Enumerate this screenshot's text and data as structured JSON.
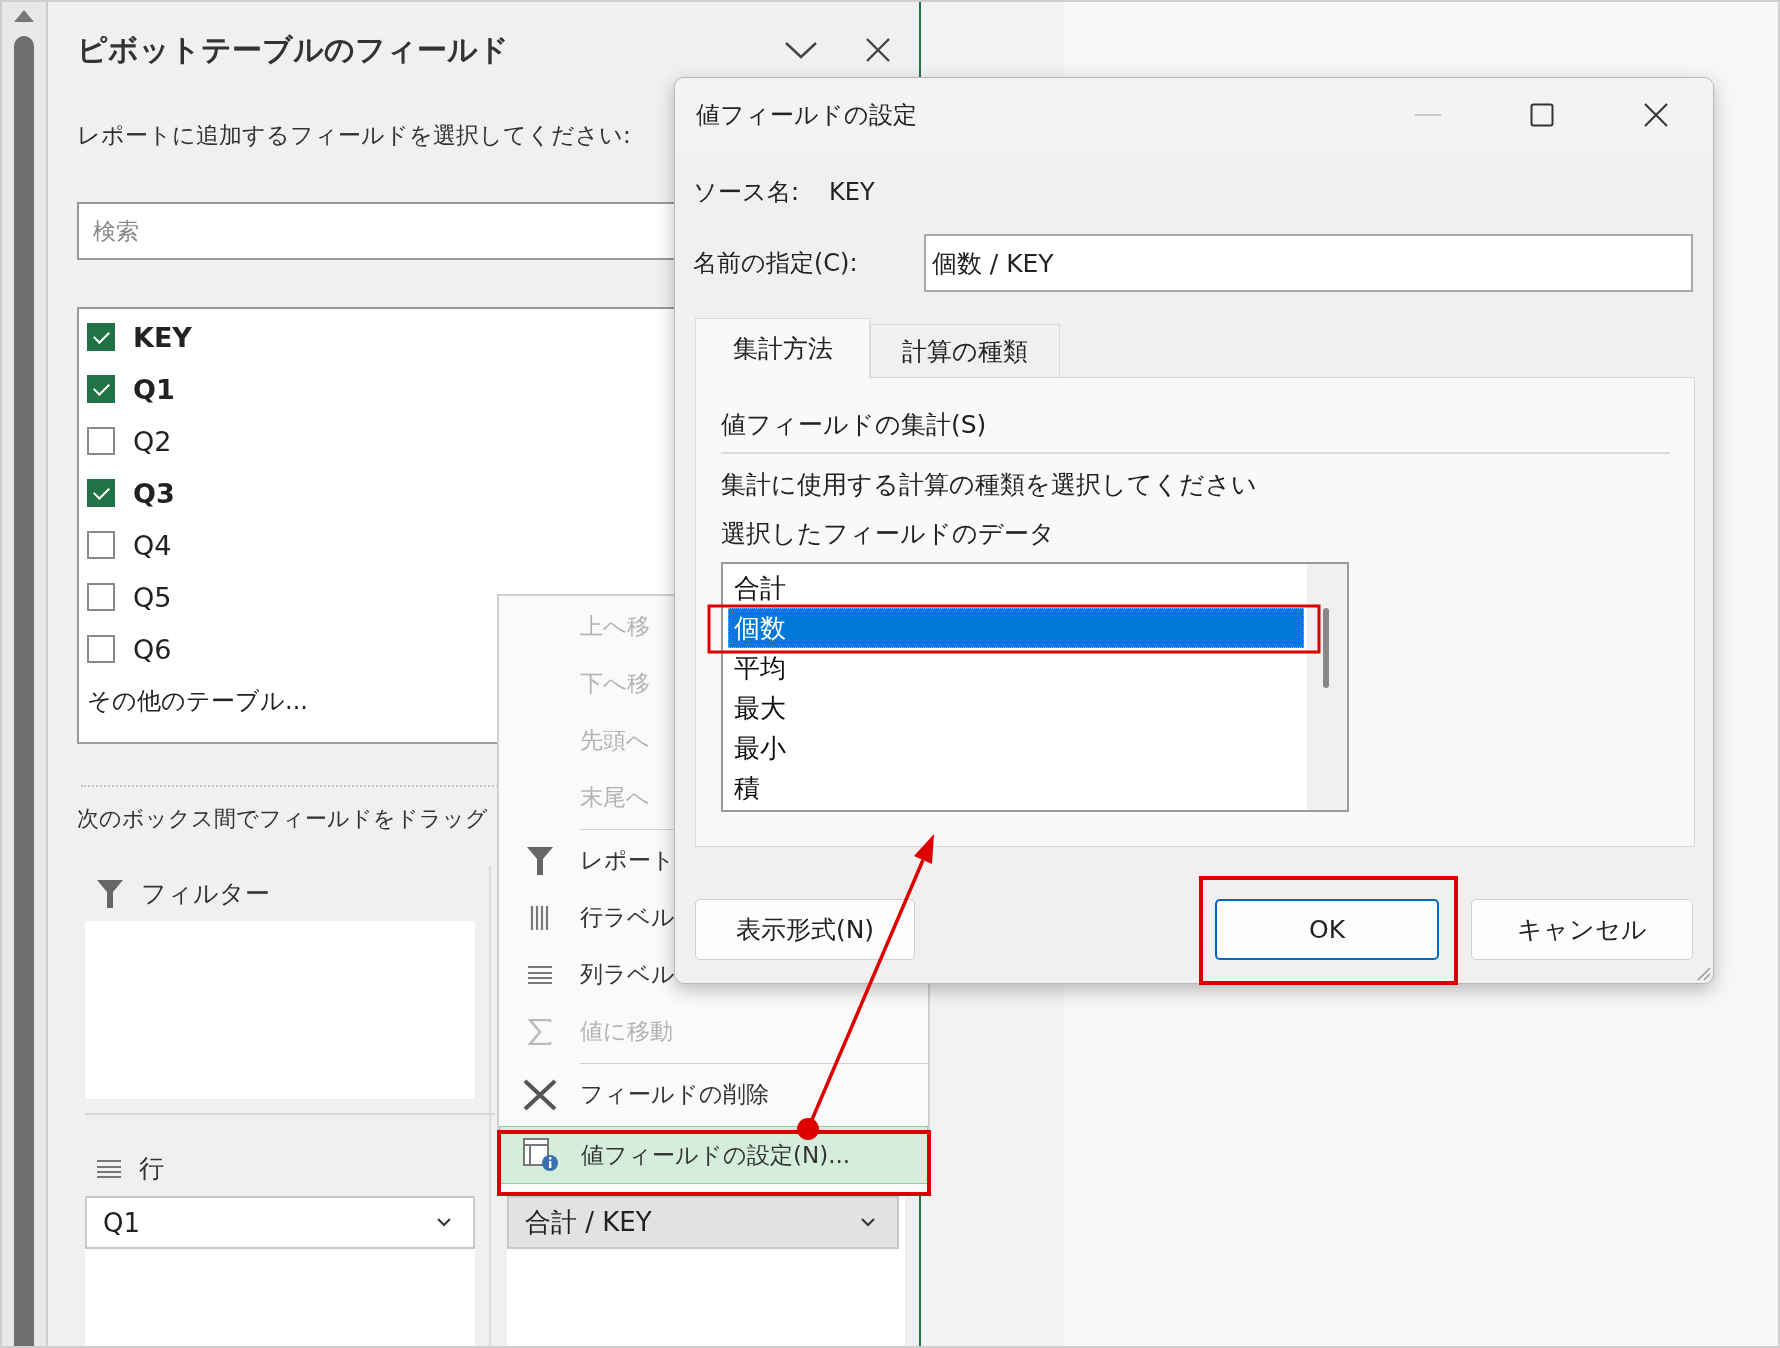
{
  "pivot_pane": {
    "title": "ピボットテーブルのフィールド",
    "instruction": "レポートに追加するフィールドを選択してください:",
    "search": {
      "placeholder": "検索"
    },
    "fields": [
      {
        "label": "KEY",
        "checked": true
      },
      {
        "label": "Q1",
        "checked": true
      },
      {
        "label": "Q2",
        "checked": false
      },
      {
        "label": "Q3",
        "checked": true
      },
      {
        "label": "Q4",
        "checked": false
      },
      {
        "label": "Q5",
        "checked": false
      },
      {
        "label": "Q6",
        "checked": false
      }
    ],
    "more_tables": "その他のテーブル...",
    "drag_hint": "次のボックス間でフィールドをドラッグ",
    "filters": {
      "label": "フィルター"
    },
    "rows": {
      "label": "行",
      "items": [
        "Q1"
      ]
    },
    "values": {
      "items": [
        "合計 / KEY"
      ]
    }
  },
  "context_menu": {
    "items": [
      {
        "kind": "move",
        "label": "上へ移",
        "disabled": true,
        "selected": false
      },
      {
        "kind": "move",
        "label": "下へ移",
        "disabled": true,
        "selected": false
      },
      {
        "kind": "move",
        "label": "先頭へ",
        "disabled": true,
        "selected": false
      },
      {
        "kind": "move",
        "label": "末尾へ",
        "disabled": true,
        "selected": false
      },
      {
        "kind": "filter",
        "label": "レポート",
        "disabled": false,
        "selected": false
      },
      {
        "kind": "rows",
        "label": "行ラベル",
        "disabled": false,
        "selected": false
      },
      {
        "kind": "columns",
        "label": "列ラベル",
        "disabled": false,
        "selected": false
      },
      {
        "kind": "values",
        "label": "値に移動",
        "disabled": true,
        "selected": false
      },
      {
        "kind": "remove",
        "label": "フィールドの削除",
        "disabled": false,
        "selected": false
      },
      {
        "kind": "settings",
        "label": "値フィールドの設定(N)...",
        "disabled": false,
        "selected": true
      }
    ]
  },
  "dialog": {
    "title": "値フィールドの設定",
    "source_label": "ソース名:",
    "source_value": "KEY",
    "name_label": "名前の指定(C):",
    "name_value": "個数 / KEY",
    "tabs": [
      {
        "label": "集計方法",
        "selected": true
      },
      {
        "label": "計算の種類",
        "selected": false
      }
    ],
    "summary_heading": "値フィールドの集計(S)",
    "description": [
      "集計に使用する計算の種類を選択してください",
      "選択したフィールドのデータ"
    ],
    "functions": [
      {
        "label": "合計",
        "selected": false
      },
      {
        "label": "個数",
        "selected": true
      },
      {
        "label": "平均",
        "selected": false
      },
      {
        "label": "最大",
        "selected": false
      },
      {
        "label": "最小",
        "selected": false
      },
      {
        "label": "積",
        "selected": false
      }
    ],
    "buttons": [
      {
        "label": "表示形式(N)",
        "default": false
      },
      {
        "label": "OK",
        "default": true
      },
      {
        "label": "キャンセル",
        "default": false
      }
    ]
  }
}
